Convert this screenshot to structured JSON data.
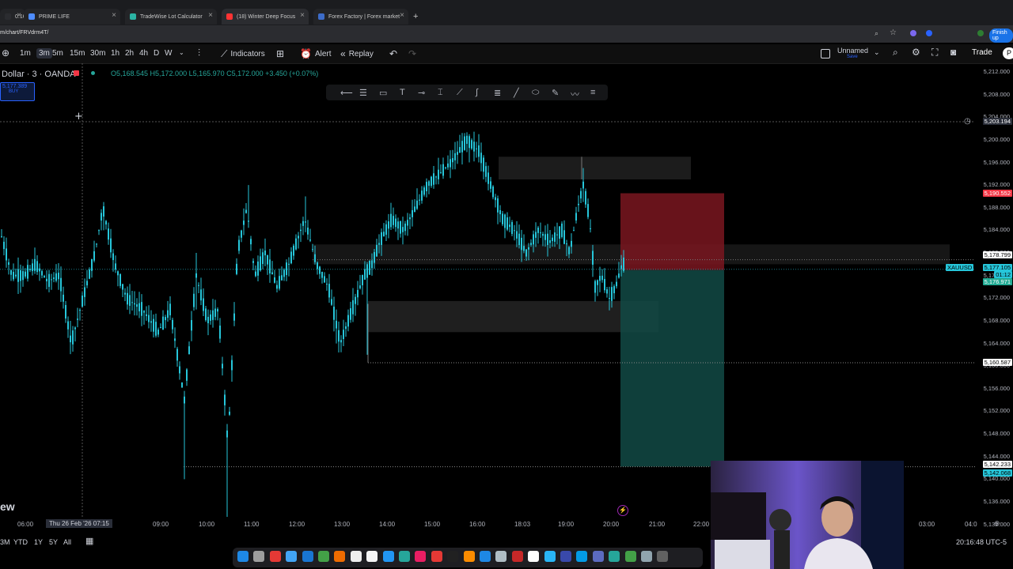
{
  "browser": {
    "tabs": [
      {
        "label": "0.16%",
        "color": "#2b2c30",
        "active": false
      },
      {
        "label": "PRIME LIFE",
        "color": "#4e8cff",
        "active": false
      },
      {
        "label": "TradeWise Lot Calculator",
        "color": "#2bb3a3",
        "active": false
      },
      {
        "label": "(18) Winter Deep Focus",
        "color": "#ff3333",
        "active": true
      },
      {
        "label": "Forex Factory | Forex market",
        "color": "#3d6cc9",
        "active": false
      }
    ],
    "url": "m/chart/FRVdrm4T/",
    "finish_label": "Finish up"
  },
  "toolbar": {
    "timeframes": [
      "1m",
      "3m",
      "5m",
      "15m",
      "30m",
      "1h",
      "2h",
      "4h",
      "D",
      "W"
    ],
    "selected_timeframe": "3m",
    "indicators_label": "Indicators",
    "alert_label": "Alert",
    "replay_label": "Replay",
    "layout_name": "Unnamed",
    "layout_sub": "Save",
    "trade_label": "Trade",
    "publish_label": "P"
  },
  "symbol": {
    "name": "Dollar · 3 · OANDA",
    "ohlc": "O5,168.545 H5,172.000 L5,165.970 C5,172.000 +3.450 (+0.07%)",
    "live_price": "5,177.389",
    "live_side": "BUY"
  },
  "y_axis": {
    "labels": [
      "5,212.000",
      "5,208.000",
      "5,204.000",
      "5,200.000",
      "5,196.000",
      "5,192.000",
      "5,188.000",
      "5,184.000",
      "5,180.000",
      "5,176.000",
      "5,172.000",
      "5,168.000",
      "5,164.000",
      "5,160.000",
      "5,156.000",
      "5,152.000",
      "5,148.000",
      "5,144.000",
      "5,140.000",
      "5,136.000",
      "5,132.000"
    ],
    "crosshair_price": "5,203.194",
    "sl_price": "5,190.552",
    "level_1": "5,178.799",
    "current_symbol": "XAUUSD",
    "current_price": "5,177.105",
    "countdown": "01:12",
    "entry_price": "5,176.971",
    "level_low": "5,160.587",
    "tp_a": "5,142.233",
    "tp_b": "5,142.068",
    "colors": {
      "sl": "#f23645",
      "tp": "#22ab94",
      "current": "#26c6da"
    }
  },
  "x_axis": {
    "labels": [
      "06:00",
      "09:00",
      "10:00",
      "11:00",
      "12:00",
      "13:00",
      "14:00",
      "15:00",
      "16:00",
      "18:03",
      "19:00",
      "20:00",
      "21:00",
      "22:00",
      "03:00",
      "04:0"
    ],
    "crosshair_label": "Thu 26 Feb '26  07:15"
  },
  "bottombar": {
    "ranges": [
      "3M",
      "YTD",
      "1Y",
      "5Y",
      "All"
    ],
    "clock": "20:16:48 UTC-5"
  },
  "watermark": "ew",
  "chart_data": {
    "type": "candlestick",
    "symbol": "XAUUSD",
    "ylim": [
      5130,
      5214
    ],
    "y_ticks": [
      5212,
      5208,
      5204,
      5200,
      5196,
      5192,
      5188,
      5184,
      5180,
      5176,
      5172,
      5168,
      5164,
      5160,
      5156,
      5152,
      5148,
      5144,
      5140,
      5136,
      5132
    ],
    "position": {
      "side": "short",
      "entry": 5176.971,
      "stop": 5190.552,
      "target": 5142.233
    },
    "candle_color": "#26c6da"
  }
}
